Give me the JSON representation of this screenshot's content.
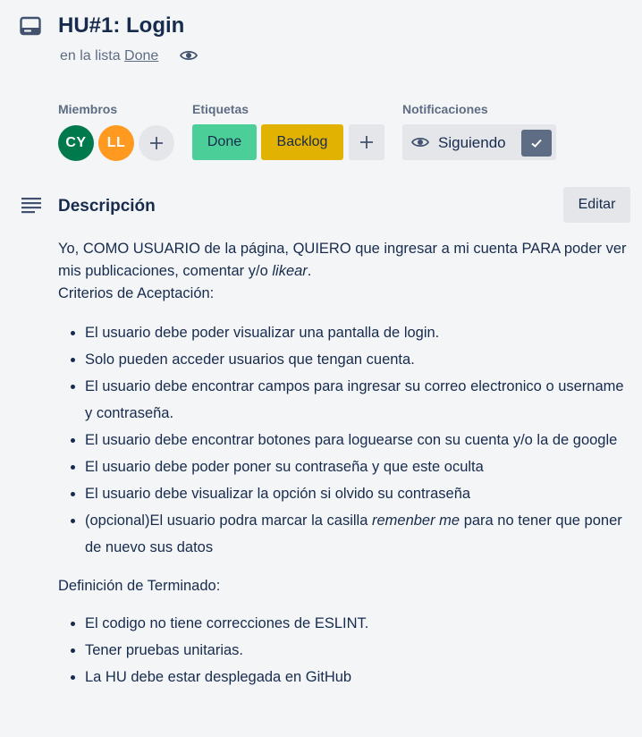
{
  "card": {
    "title": "HU#1: Login",
    "in_list_prefix": "en la lista",
    "list_name": "Done"
  },
  "members": {
    "label": "Miembros",
    "avatars": [
      {
        "initials": "CY",
        "color": "#007a4d"
      },
      {
        "initials": "LL",
        "color": "#ff991f"
      }
    ],
    "add_icon": "plus-icon"
  },
  "labels": {
    "label": "Etiquetas",
    "items": [
      {
        "text": "Done",
        "color": "#4bce97"
      },
      {
        "text": "Backlog",
        "color": "#e2b203"
      }
    ],
    "add_icon": "plus-icon"
  },
  "notifications": {
    "label": "Notificaciones",
    "button_text": "Siguiendo",
    "icon": "eye-icon",
    "checked": true
  },
  "description": {
    "heading": "Descripción",
    "edit_label": "Editar",
    "intro_a": "Yo, COMO USUARIO de la página, QUIERO que ingresar a mi cuenta PARA poder ver mis publicaciones, comentar y/o ",
    "intro_em": "likear",
    "intro_b": ".",
    "criteria_heading": "Criterios de Aceptación:",
    "criteria": [
      "El usuario debe poder visualizar una pantalla de login.",
      "Solo pueden acceder usuarios que tengan cuenta.",
      "El usuario debe encontrar campos para ingresar su correo electronico o username y contraseña.",
      "El usuario debe encontrar botones para loguearse con su cuenta y/o la de google",
      "El usuario debe poder poner su contraseña y que este oculta",
      "El usuario debe visualizar la opción si olvido su contraseña"
    ],
    "criteria_last_a": "(opcional)El usuario podra marcar la casilla ",
    "criteria_last_em": "remenber me",
    "criteria_last_b": " para no tener que poner de nuevo sus datos",
    "done_heading": "Definición de Terminado:",
    "done": [
      "El codigo no tiene correcciones de ESLINT.",
      "Tener pruebas unitarias.",
      "La HU debe estar desplegada en GitHub"
    ]
  },
  "colors": {
    "text": "#172b4d",
    "muted": "#5e6c84",
    "button_bg": "#e4e6ea",
    "page_bg": "#f4f5f7"
  }
}
